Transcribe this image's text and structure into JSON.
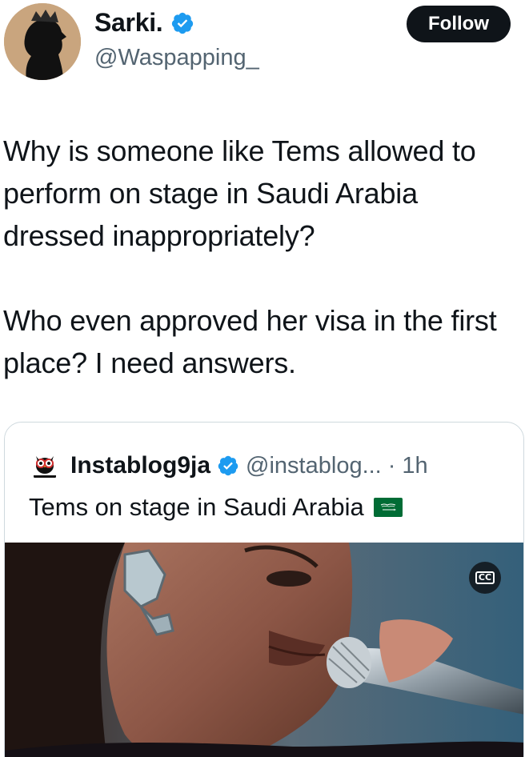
{
  "author": {
    "display_name": "Sarki.",
    "handle": "@Waspapping_",
    "verified_icon": "verified-badge-icon",
    "avatar_icon": "silhouette-avatar"
  },
  "follow_button": {
    "label": "Follow"
  },
  "tweet": {
    "paragraphs": [
      "Why is someone like Tems allowed to perform on stage in Saudi Arabia dressed inappropriately?",
      "Who even approved her visa in the first place? I need answers."
    ]
  },
  "quoted_tweet": {
    "display_name": "Instablog9ja",
    "handle": "@instablog...",
    "separator": "·",
    "time": "1h",
    "text": "Tems on stage in Saudi Arabia",
    "flag_icon": "saudi-arabia-flag-icon",
    "media": {
      "type": "video",
      "cc_label": "CC"
    }
  },
  "colors": {
    "primary_text": "#0f1419",
    "secondary_text": "#536471",
    "verified_blue": "#1d9bf0",
    "border": "#cfd9de",
    "button_bg": "#0f1419"
  }
}
